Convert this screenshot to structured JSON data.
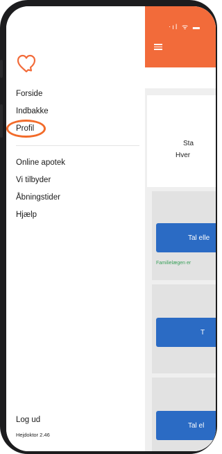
{
  "colors": {
    "brand": "#f26b3a",
    "primary_button": "#2b6bc4",
    "note_green": "#3aa05a",
    "highlight": "#f26b2a"
  },
  "app": {
    "status_icons": "⋅ıl ᯤ ▬",
    "card1": {
      "line1": "Sta",
      "line2": "Hver"
    },
    "buttons": [
      "Tal elle",
      "T",
      "Tal el"
    ],
    "note": "Familielægen er"
  },
  "drawer": {
    "logo_icon": "heart-chat-icon",
    "primary_items": [
      "Forside",
      "Indbakke",
      "Profil"
    ],
    "secondary_items": [
      "Online apotek",
      "Vi tilbyder",
      "Åbningstider",
      "Hjælp"
    ],
    "logout": "Log ud",
    "version": "Hejdoktor 2.46"
  }
}
